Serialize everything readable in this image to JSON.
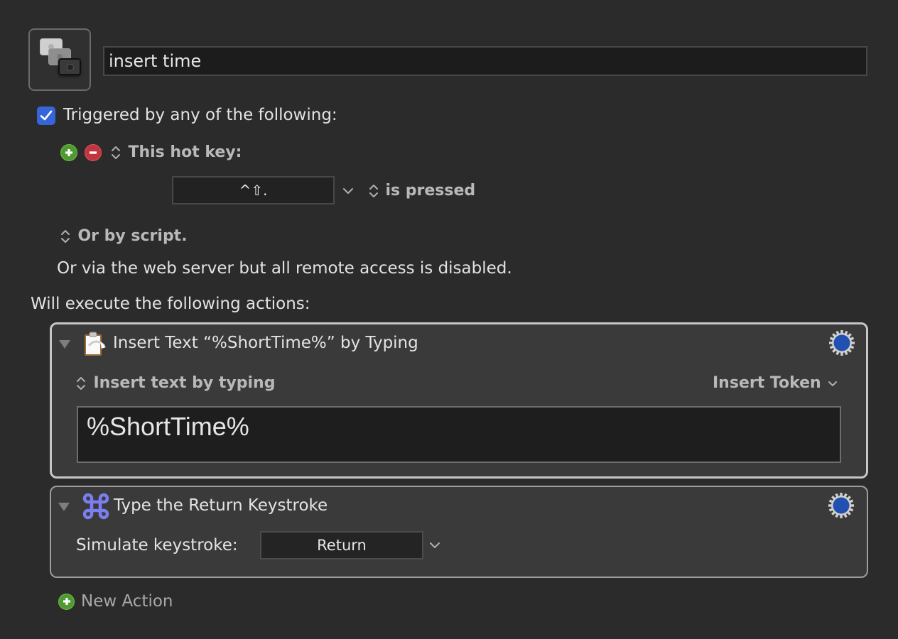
{
  "macro": {
    "icon": "macro-group-stack-icon",
    "name": "insert time"
  },
  "triggers": {
    "checkbox_checked": true,
    "heading": "Triggered by any of the following:",
    "add_icon": "plus-circle-icon",
    "remove_icon": "minus-circle-icon",
    "trigger_type": "This hot key:",
    "hotkey": "^⇧.",
    "hotkey_condition": "is pressed",
    "script_option": "Or by script.",
    "web_server_note": "Or via the web server but all remote access is disabled."
  },
  "actions": {
    "heading": "Will execute the following actions:",
    "items": [
      {
        "title": "Insert Text “%ShortTime%” by Typing",
        "icon": "clipboard-insert-icon",
        "mode": "Insert text by typing",
        "token_menu": "Insert Token",
        "text": "%ShortTime%"
      },
      {
        "title": "Type the Return Keystroke",
        "icon": "command-key-icon",
        "field_label": "Simulate keystroke:",
        "keystroke": "Return"
      }
    ],
    "new_action_label": "New Action"
  },
  "colors": {
    "checkbox": "#3565d8",
    "add": "#4f9a33",
    "remove": "#c1363e",
    "gear_center": "#2250b0",
    "command_icon": "#7b7ef0"
  }
}
